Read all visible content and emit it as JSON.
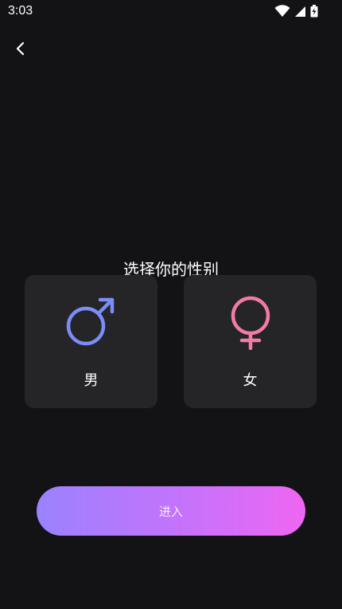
{
  "status_bar": {
    "time": "3:03",
    "icons": [
      "wifi-icon",
      "signal-icon",
      "battery-icon"
    ]
  },
  "header": {
    "back_icon": "chevron-left-icon"
  },
  "title": "选择你的性别",
  "genders": [
    {
      "label": "男",
      "icon": "male-symbol-icon",
      "color": "#7c8cf8"
    },
    {
      "label": "女",
      "icon": "female-symbol-icon",
      "color": "#f47aa7"
    }
  ],
  "enter_button": {
    "label": "进入",
    "gradient": [
      "#9a82ff",
      "#ee66f3"
    ]
  },
  "colors": {
    "background": "#131215",
    "card": "#252528"
  }
}
